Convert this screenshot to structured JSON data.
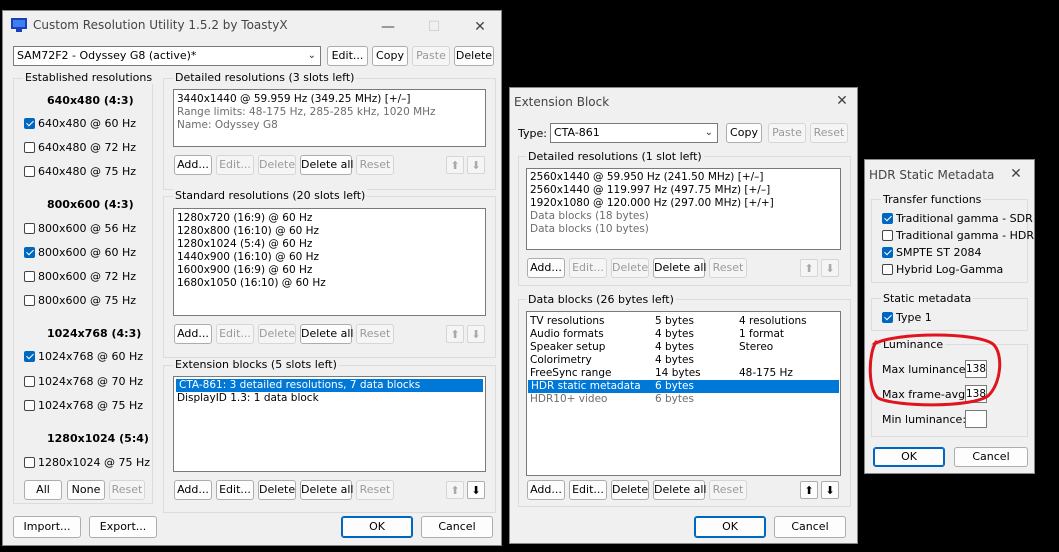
{
  "cru": {
    "title": "Custom Resolution Utility 1.5.2 by ToastyX",
    "monitor": "SAM72F2 - Odyssey G8 (active)*",
    "buttons": {
      "edit": "Edit...",
      "copy": "Copy",
      "paste": "Paste",
      "delete": "Delete"
    },
    "established": {
      "label": "Established resolutions",
      "groups": [
        {
          "header": "640x480 (4:3)",
          "items": [
            {
              "label": "640x480 @ 60 Hz",
              "checked": true
            },
            {
              "label": "640x480 @ 72 Hz",
              "checked": false
            },
            {
              "label": "640x480 @ 75 Hz",
              "checked": false
            }
          ]
        },
        {
          "header": "800x600 (4:3)",
          "items": [
            {
              "label": "800x600 @ 56 Hz",
              "checked": false
            },
            {
              "label": "800x600 @ 60 Hz",
              "checked": true
            },
            {
              "label": "800x600 @ 72 Hz",
              "checked": false
            },
            {
              "label": "800x600 @ 75 Hz",
              "checked": false
            }
          ]
        },
        {
          "header": "1024x768 (4:3)",
          "items": [
            {
              "label": "1024x768 @ 60 Hz",
              "checked": true
            },
            {
              "label": "1024x768 @ 70 Hz",
              "checked": false
            },
            {
              "label": "1024x768 @ 75 Hz",
              "checked": false
            }
          ]
        },
        {
          "header": "1280x1024 (5:4)",
          "items": [
            {
              "label": "1280x1024 @ 75 Hz",
              "checked": false
            }
          ]
        }
      ],
      "all": "All",
      "none": "None",
      "reset": "Reset"
    },
    "detailed": {
      "label": "Detailed resolutions (3 slots left)",
      "lines": [
        {
          "text": "3440x1440 @ 59.959 Hz (349.25 MHz) [+/–]",
          "gray": false
        },
        {
          "text": "Range limits: 48-175 Hz, 285-285 kHz, 1020 MHz",
          "gray": true
        },
        {
          "text": "Name: Odyssey G8",
          "gray": true
        }
      ]
    },
    "standard": {
      "label": "Standard resolutions (20 slots left)",
      "lines": [
        "1280x720 (16:9) @ 60 Hz",
        "1280x800 (16:10) @ 60 Hz",
        "1280x1024 (5:4) @ 60 Hz",
        "1440x900 (16:10) @ 60 Hz",
        "1600x900 (16:9) @ 60 Hz",
        "1680x1050 (16:10) @ 60 Hz"
      ]
    },
    "extension": {
      "label": "Extension blocks (5 slots left)",
      "lines": [
        {
          "text": "CTA-861: 3 detailed resolutions, 7 data blocks",
          "selected": true
        },
        {
          "text": "DisplayID 1.3: 1 data block",
          "selected": false
        }
      ]
    },
    "list_buttons": {
      "add": "Add...",
      "edit": "Edit...",
      "delete": "Delete",
      "delete_all": "Delete all",
      "reset": "Reset"
    },
    "import": "Import...",
    "export": "Export...",
    "ok": "OK",
    "cancel": "Cancel"
  },
  "ext": {
    "title": "Extension Block",
    "type_label": "Type:",
    "type_value": "CTA-861",
    "copy": "Copy",
    "paste": "Paste",
    "reset": "Reset",
    "detailed": {
      "label": "Detailed resolutions (1 slot left)",
      "lines": [
        {
          "text": "2560x1440 @ 59.950 Hz (241.50 MHz) [+/–]",
          "gray": false
        },
        {
          "text": "2560x1440 @ 119.997 Hz (497.75 MHz) [+/–]",
          "gray": false
        },
        {
          "text": "1920x1080 @ 120.000 Hz (297.00 MHz) [+/+]",
          "gray": false
        },
        {
          "text": "Data blocks (18 bytes)",
          "gray": true
        },
        {
          "text": "Data blocks (10 bytes)",
          "gray": true
        }
      ]
    },
    "datablocks": {
      "label": "Data blocks (26 bytes left)",
      "rows": [
        {
          "name": "TV resolutions",
          "size": "5 bytes",
          "info": "4 resolutions",
          "state": "normal"
        },
        {
          "name": "Audio formats",
          "size": "4 bytes",
          "info": "1 format",
          "state": "normal"
        },
        {
          "name": "Speaker setup",
          "size": "4 bytes",
          "info": "Stereo",
          "state": "normal"
        },
        {
          "name": "Colorimetry",
          "size": "4 bytes",
          "info": "",
          "state": "normal"
        },
        {
          "name": "FreeSync range",
          "size": "14 bytes",
          "info": "48-175 Hz",
          "state": "normal"
        },
        {
          "name": "HDR static metadata",
          "size": "6 bytes",
          "info": "",
          "state": "selected"
        },
        {
          "name": "HDR10+ video",
          "size": "6 bytes",
          "info": "",
          "state": "gray"
        }
      ]
    },
    "list_buttons": {
      "add": "Add...",
      "edit": "Edit...",
      "delete": "Delete",
      "delete_all": "Delete all",
      "reset": "Reset"
    },
    "ok": "OK",
    "cancel": "Cancel"
  },
  "hdr": {
    "title": "HDR Static Metadata",
    "transfer_label": "Transfer functions",
    "transfer": [
      {
        "label": "Traditional gamma - SDR",
        "checked": true
      },
      {
        "label": "Traditional gamma - HDR",
        "checked": false
      },
      {
        "label": "SMPTE ST 2084",
        "checked": true
      },
      {
        "label": "Hybrid Log-Gamma",
        "checked": false
      }
    ],
    "static_label": "Static metadata",
    "type1": {
      "label": "Type 1",
      "checked": true
    },
    "luminance_label": "Luminance",
    "max_lum_label": "Max luminance:",
    "max_lum": "138",
    "max_frame_label": "Max frame-avg:",
    "max_frame": "138",
    "min_lum_label": "Min luminance:",
    "min_lum": "",
    "ok": "OK",
    "cancel": "Cancel",
    "annotation_color": "#e0141e"
  }
}
